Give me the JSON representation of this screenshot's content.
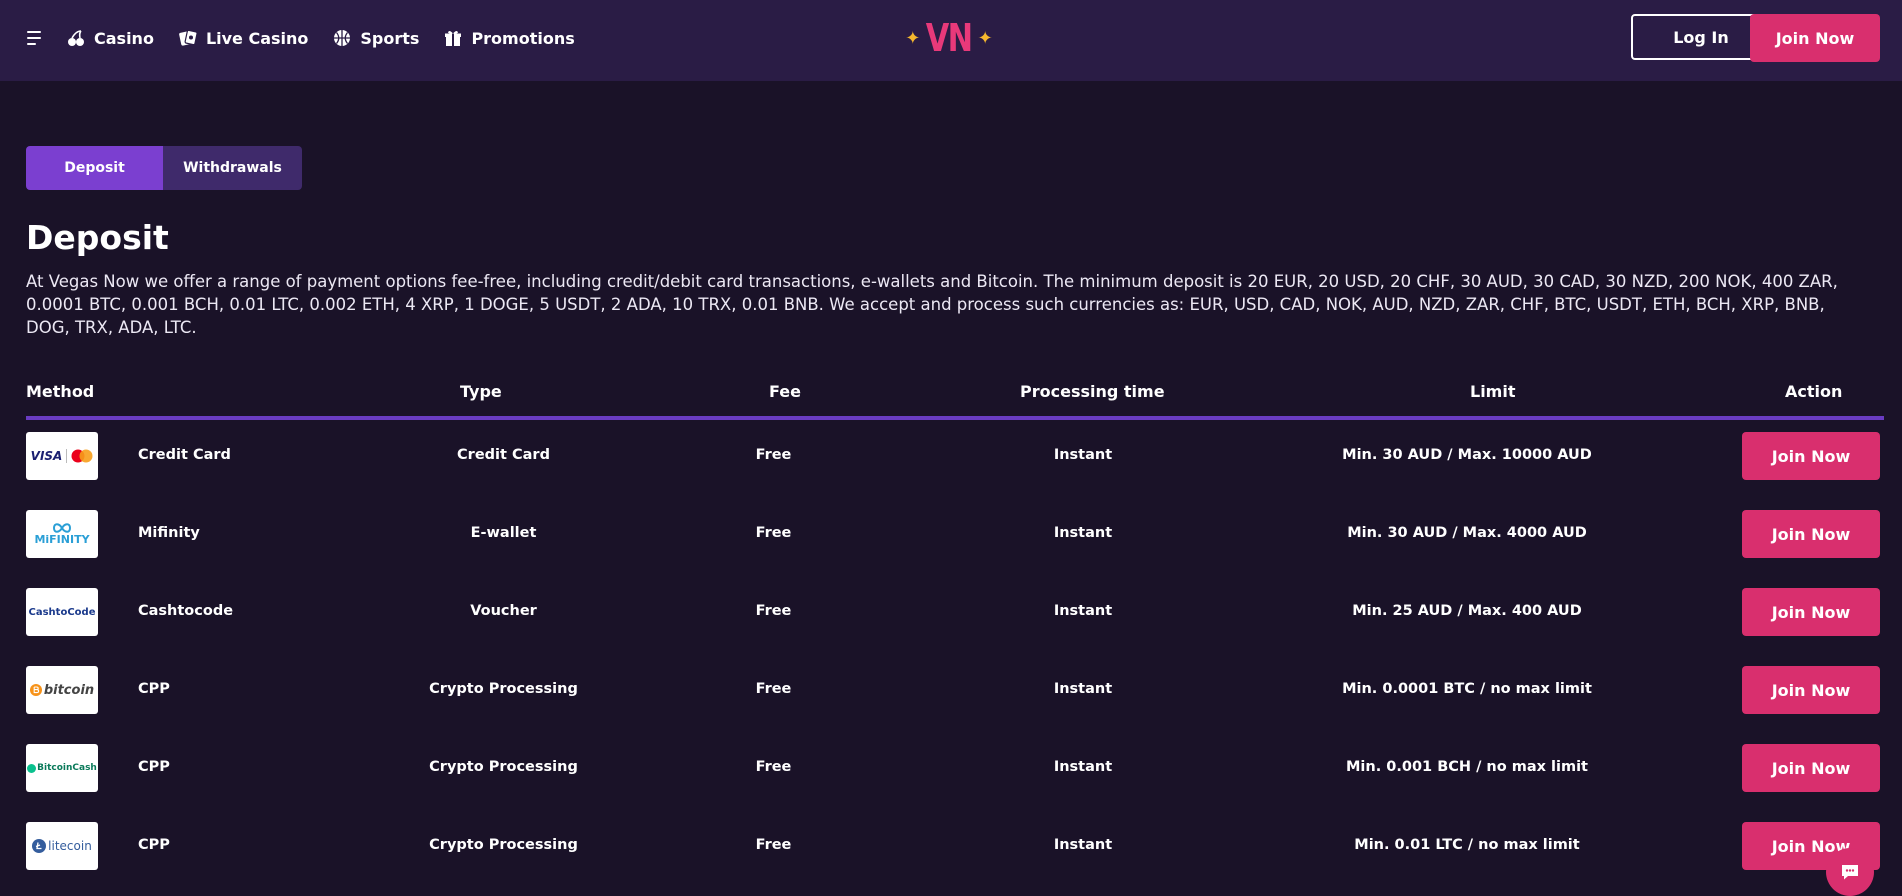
{
  "nav": {
    "items": [
      {
        "label": "Casino",
        "icon": "cherries-icon"
      },
      {
        "label": "Live Casino",
        "icon": "cards-icon"
      },
      {
        "label": "Sports",
        "icon": "basketball-icon"
      },
      {
        "label": "Promotions",
        "icon": "gift-icon"
      }
    ]
  },
  "logo": {
    "text": "VN"
  },
  "header": {
    "login_label": "Log In",
    "join_label": "Join Now"
  },
  "tabs": [
    {
      "label": "Deposit",
      "active": true
    },
    {
      "label": "Withdrawals",
      "active": false
    }
  ],
  "page": {
    "title": "Deposit",
    "intro": "At Vegas Now we offer a range of payment options fee-free, including credit/debit card transactions, e-wallets and Bitcoin. The minimum deposit is 20 EUR, 20 USD, 20 CHF, 30 AUD, 30 CAD, 30 NZD, 200 NOK, 400 ZAR, 0.0001 BTC, 0.001 BCH, 0.01 LTC, 0.002 ETH, 4 XRP, 1 DOGE, 5 USDT, 2 ADA, 10 TRX, 0.01 BNB. We accept and process such currencies as: EUR, USD, CAD, NOK, AUD, NZD, ZAR, CHF, BTC, USDT, ETH, BCH, XRP, BNB, DOG, TRX, ADA, LTC."
  },
  "table": {
    "headers": {
      "method": "Method",
      "type": "Type",
      "fee": "Fee",
      "processing": "Processing time",
      "limit": "Limit",
      "action": "Action"
    },
    "rows": [
      {
        "logo_text": "VISA",
        "method": "Credit Card",
        "type": "Credit Card",
        "fee": "Free",
        "processing": "Instant",
        "limit": "Min. 30 AUD / Max. 10000 AUD",
        "action": "Join Now"
      },
      {
        "logo_text": "MiFINITY",
        "method": "Mifinity",
        "type": "E-wallet",
        "fee": "Free",
        "processing": "Instant",
        "limit": "Min. 30 AUD / Max. 4000 AUD",
        "action": "Join Now"
      },
      {
        "logo_text": "CashtoCode",
        "method": "Cashtocode",
        "type": "Voucher",
        "fee": "Free",
        "processing": "Instant",
        "limit": "Min. 25 AUD / Max. 400 AUD",
        "action": "Join Now"
      },
      {
        "logo_text": "bitcoin",
        "method": "CPP",
        "type": "Crypto Processing",
        "fee": "Free",
        "processing": "Instant",
        "limit": "Min. 0.0001 BTC / no max limit",
        "action": "Join Now"
      },
      {
        "logo_text": "BitcoinCash",
        "method": "CPP",
        "type": "Crypto Processing",
        "fee": "Free",
        "processing": "Instant",
        "limit": "Min. 0.001 BCH / no max limit",
        "action": "Join Now"
      },
      {
        "logo_text": "litecoin",
        "method": "CPP",
        "type": "Crypto Processing",
        "fee": "Free",
        "processing": "Instant",
        "limit": "Min. 0.01 LTC / no max limit",
        "action": "Join Now"
      }
    ]
  },
  "colors": {
    "background": "#1a1228",
    "header": "#2a1c45",
    "accent": "#d92f6e",
    "tab_active": "#7b3fd0",
    "tab_inactive": "#3f2a6b",
    "divider": "#6a3cc2",
    "logo_star": "#f5b82e"
  }
}
